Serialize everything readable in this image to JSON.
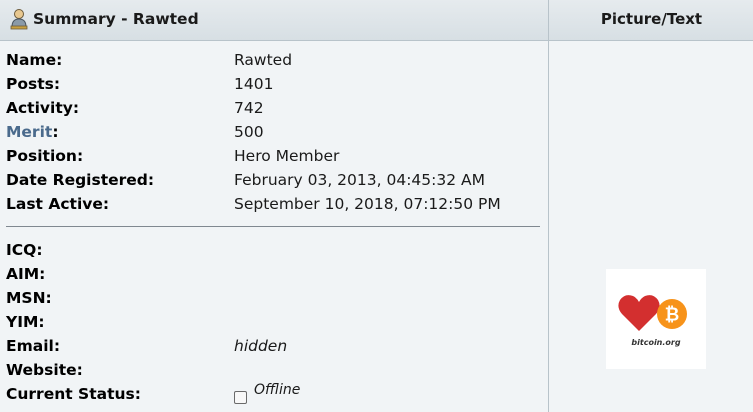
{
  "header": {
    "title": "Summary - Rawted",
    "picture_text": "Picture/Text"
  },
  "profile": {
    "name_label": "Name:",
    "name_value": "Rawted",
    "posts_label": "Posts:",
    "posts_value": "1401",
    "activity_label": "Activity:",
    "activity_value": "742",
    "merit_label": "Merit",
    "merit_colon": ":",
    "merit_value": "500",
    "position_label": "Position:",
    "position_value": "Hero Member",
    "registered_label": "Date Registered:",
    "registered_value": "February 03, 2013, 04:45:32 AM",
    "last_active_label": "Last Active:",
    "last_active_value": "September 10, 2018, 07:12:50 PM"
  },
  "contact": {
    "icq_label": "ICQ:",
    "aim_label": "AIM:",
    "msn_label": "MSN:",
    "yim_label": "YIM:",
    "email_label": "Email:",
    "email_value": "hidden",
    "website_label": "Website:",
    "status_label": "Current Status:",
    "status_value": "Offline"
  },
  "avatar": {
    "text": "bitcoin.org",
    "icon": "heart-bitcoin-logo",
    "heart_color": "#d32f2f",
    "coin_color": "#f7931a"
  }
}
